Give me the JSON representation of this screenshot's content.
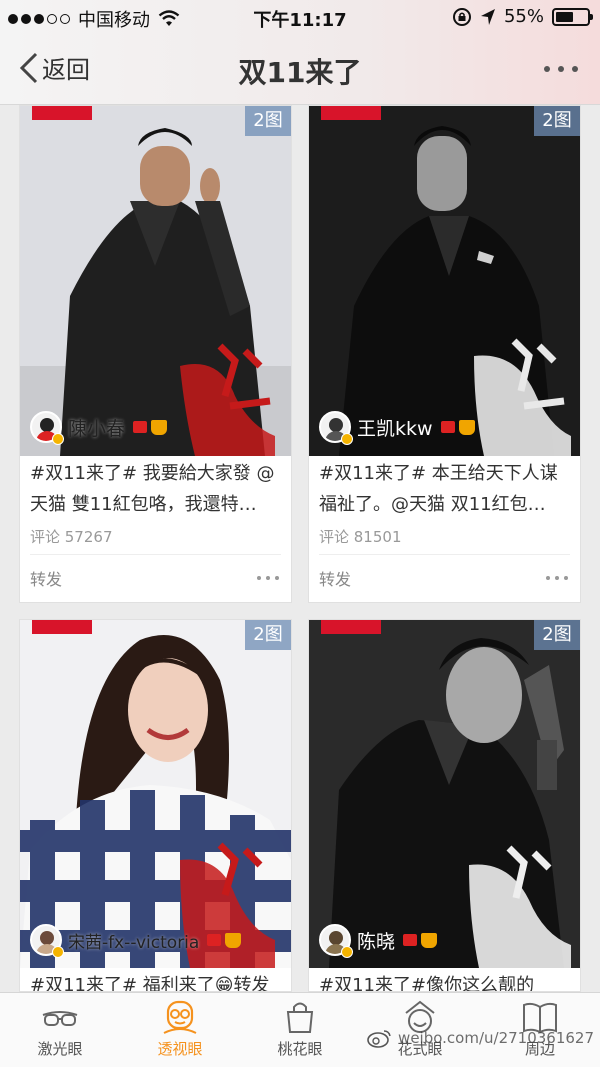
{
  "status_bar": {
    "carrier": "中国移动",
    "time": "下午11:17",
    "battery_percent": "55%",
    "battery_level": 0.55
  },
  "nav": {
    "back_label": "返回",
    "title": "双11来了"
  },
  "cards": [
    {
      "badge": "2图",
      "author": "陳小春",
      "text": "#双11来了# 我要給大家發 @天猫 雙11紅包咯，我還特…",
      "comments": "评论 57267",
      "forward": "转发"
    },
    {
      "badge": "2图",
      "author": "王凯kkw",
      "text": "#双11来了# 本王给天下人谋福祉了。@天猫 双11红包…",
      "comments": "评论 81501",
      "forward": "转发"
    },
    {
      "badge": "2图",
      "author": "宋茜-fx--victoria",
      "text": "#双11来了# 福利来了😁转发"
    },
    {
      "badge": "2图",
      "author": "陈晓",
      "text": "#双11来了#像你这么靓的"
    }
  ],
  "tabbar": {
    "items": [
      {
        "label": "激光眼",
        "icon": "glasses-icon"
      },
      {
        "label": "透视眼",
        "icon": "face-glasses-icon"
      },
      {
        "label": "桃花眼",
        "icon": "handbag-icon"
      },
      {
        "label": "花式眼",
        "icon": "smiley-icon"
      },
      {
        "label": "周边",
        "icon": "book-icon"
      }
    ],
    "active_index": 1
  },
  "watermark": "weibo.com/u/2710361627",
  "colors": {
    "accent": "#f5921e",
    "badge": "#6e8cb4",
    "tag_red": "#d8142a"
  }
}
